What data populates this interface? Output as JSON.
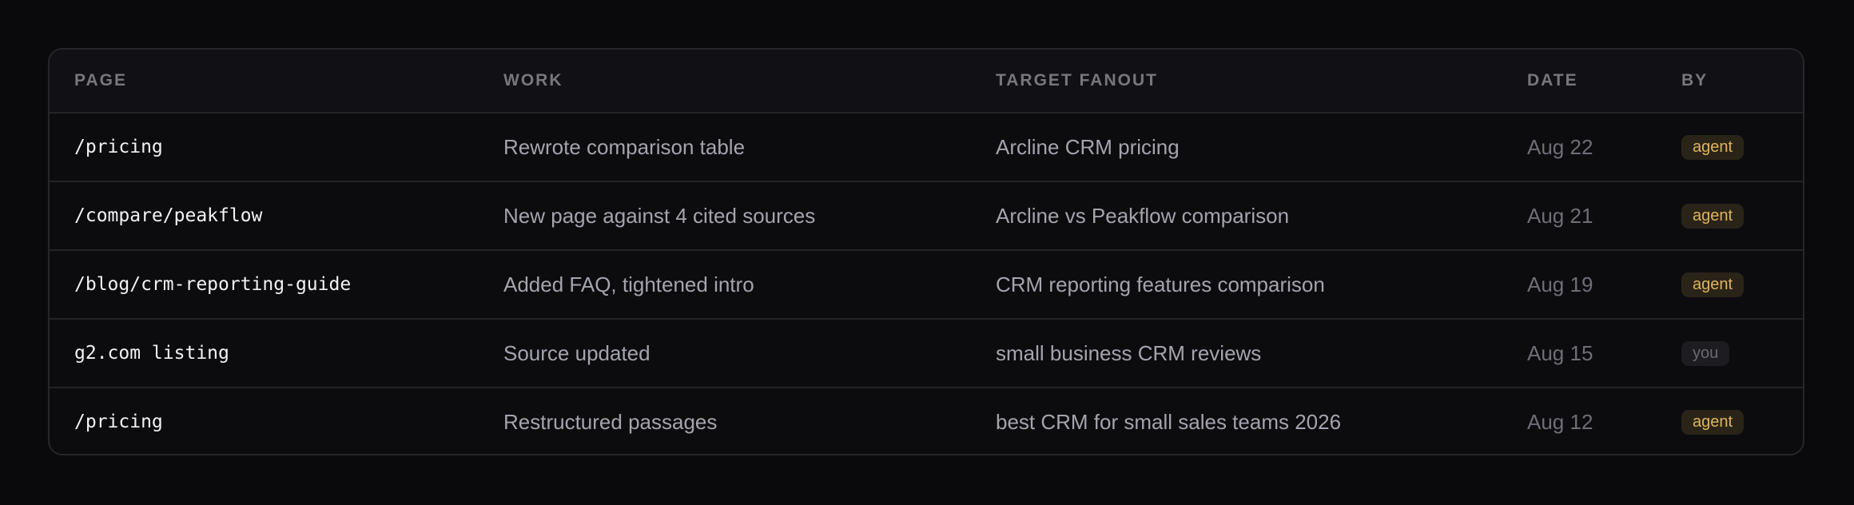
{
  "table": {
    "headers": {
      "page": "PAGE",
      "work": "WORK",
      "target": "TARGET FANOUT",
      "date": "DATE",
      "by": "BY"
    },
    "rows": [
      {
        "page": "/pricing",
        "work": "Rewrote comparison table",
        "target": "Arcline CRM pricing",
        "date": "Aug 22",
        "by": "agent"
      },
      {
        "page": "/compare/peakflow",
        "work": "New page against 4 cited sources",
        "target": "Arcline vs Peakflow comparison",
        "date": "Aug 21",
        "by": "agent"
      },
      {
        "page": "/blog/crm-reporting-guide",
        "work": "Added FAQ, tightened intro",
        "target": "CRM reporting features comparison",
        "date": "Aug 19",
        "by": "agent"
      },
      {
        "page": "g2.com listing",
        "work": "Source updated",
        "target": "small business CRM reviews",
        "date": "Aug 15",
        "by": "you"
      },
      {
        "page": "/pricing",
        "work": "Restructured passages",
        "target": "best CRM for small sales teams 2026",
        "date": "Aug 12",
        "by": "agent"
      }
    ]
  },
  "colors": {
    "background": "#0a0a0c",
    "badge_agent_text": "#e0b45c",
    "badge_agent_bg": "#2a2418",
    "badge_you_text": "#6a6a72",
    "badge_you_bg": "#1c1c21"
  }
}
